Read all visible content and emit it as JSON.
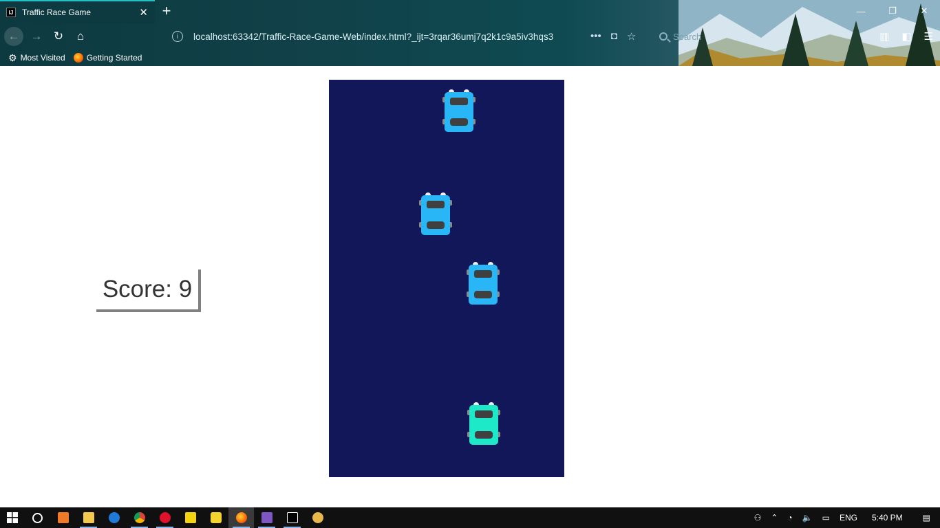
{
  "browser": {
    "tab": {
      "favicon": "IJ",
      "title": "Traffic Race Game"
    },
    "url": "localhost:63342/Traffic-Race-Game-Web/index.html?_ijt=3rqar36umj7q2k1c9a5iv3hqs3",
    "search_placeholder": "Search",
    "bookmarks": [
      {
        "label": "Most Visited",
        "icon": "gear-icon"
      },
      {
        "label": "Getting Started",
        "icon": "firefox-icon"
      }
    ]
  },
  "game": {
    "score_label": "Score: 9",
    "road_color": "#12175a",
    "cars": [
      {
        "name": "car-enemy-1",
        "color": "#29b6f6"
      },
      {
        "name": "car-enemy-2",
        "color": "#29b6f6"
      },
      {
        "name": "car-enemy-3",
        "color": "#29b6f6"
      },
      {
        "name": "car-player",
        "color": "#1de9c8"
      }
    ]
  },
  "taskbar": {
    "tray": {
      "language": "ENG",
      "time": "5:40 PM"
    }
  }
}
